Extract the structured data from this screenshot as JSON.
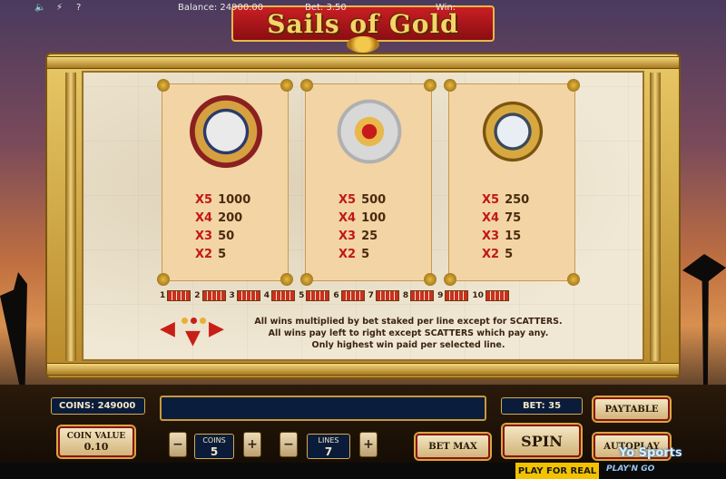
{
  "title": "Sails of Gold",
  "paytable": [
    {
      "symbol": "coat-of-arms",
      "pays": [
        {
          "mult": "X5",
          "val": "1000"
        },
        {
          "mult": "X4",
          "val": "200"
        },
        {
          "mult": "X3",
          "val": "50"
        },
        {
          "mult": "X2",
          "val": "5"
        }
      ]
    },
    {
      "symbol": "jewel-brooch",
      "pays": [
        {
          "mult": "X5",
          "val": "500"
        },
        {
          "mult": "X4",
          "val": "100"
        },
        {
          "mult": "X3",
          "val": "25"
        },
        {
          "mult": "X2",
          "val": "5"
        }
      ]
    },
    {
      "symbol": "compass",
      "pays": [
        {
          "mult": "X5",
          "val": "250"
        },
        {
          "mult": "X4",
          "val": "75"
        },
        {
          "mult": "X3",
          "val": "15"
        },
        {
          "mult": "X2",
          "val": "5"
        }
      ]
    }
  ],
  "paylines": [
    "1",
    "2",
    "3",
    "4",
    "5",
    "6",
    "7",
    "8",
    "9",
    "10"
  ],
  "rules": [
    "All wins multiplied by bet staked per line except for SCATTERS.",
    "All wins pay left to right except SCATTERS which pay any.",
    "Only highest win paid per selected line."
  ],
  "controls": {
    "coins_label": "COINS: 249000",
    "bet_label": "BET: 35",
    "paytable": "PAYTABLE",
    "coin_value_label": "COIN VALUE",
    "coin_value": "0.10",
    "coins_stepper_label": "COINS",
    "coins_stepper_value": "5",
    "lines_label": "LINES",
    "lines_value": "7",
    "bet_max": "BET MAX",
    "spin": "SPIN",
    "autoplay": "AUTOPLAY",
    "minus": "−",
    "plus": "+"
  },
  "status": {
    "balance": "Balance: 24900.00",
    "bet": "Bet: 3.50",
    "win": "Win:",
    "play_real": "PLAY FOR REAL",
    "brand": "PLAY'N GO",
    "watermark": "Yo Sports"
  }
}
